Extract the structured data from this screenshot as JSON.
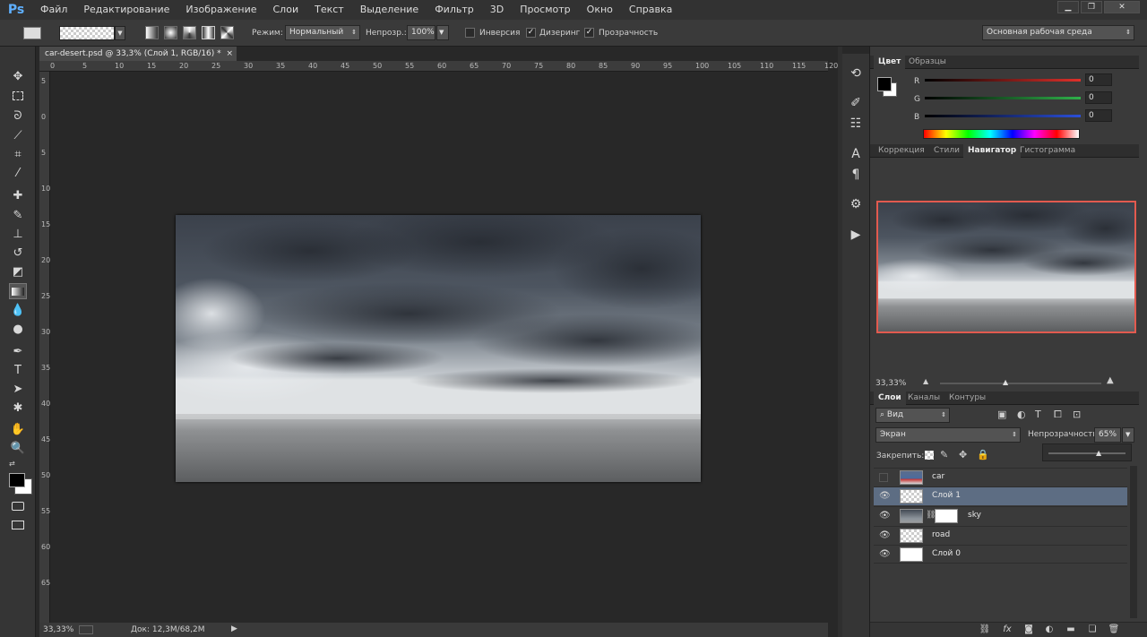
{
  "app": {
    "logo": "Ps"
  },
  "menu": [
    "Файл",
    "Редактирование",
    "Изображение",
    "Слои",
    "Текст",
    "Выделение",
    "Фильтр",
    "3D",
    "Просмотр",
    "Окно",
    "Справка"
  ],
  "window_controls": {
    "minimize": "▁",
    "restore": "❐",
    "close": "✕"
  },
  "options": {
    "mode_label": "Режим:",
    "mode_value": "Нормальный",
    "opacity_label": "Непрозр.:",
    "opacity_value": "100%",
    "inverse_label": "Инверсия",
    "dither_label": "Дизеринг",
    "transparency_label": "Прозрачность",
    "workspace_value": "Основная рабочая среда"
  },
  "document": {
    "tab_title": "car-desert.psd @ 33,3% (Слой 1, RGB/16) *",
    "ruler_top": [
      "0",
      "5",
      "10",
      "15",
      "20",
      "25",
      "30",
      "35",
      "40",
      "45",
      "50",
      "55",
      "60",
      "65",
      "70",
      "75",
      "80",
      "85",
      "90",
      "95",
      "100",
      "105",
      "110",
      "115",
      "120"
    ],
    "ruler_left": [
      "5",
      "0",
      "5",
      "10",
      "15",
      "20",
      "25",
      "30",
      "35",
      "40",
      "45",
      "50",
      "55",
      "60",
      "65"
    ]
  },
  "status": {
    "zoom": "33,33%",
    "doc_info": "Док: 12,3M/68,2M"
  },
  "color_panel": {
    "tabs": [
      "Цвет",
      "Образцы"
    ],
    "channels": [
      {
        "label": "R",
        "value": "0",
        "color": "#e0302a"
      },
      {
        "label": "G",
        "value": "0",
        "color": "#2fb14a"
      },
      {
        "label": "B",
        "value": "0",
        "color": "#2b4fd8"
      }
    ]
  },
  "navigator_panel": {
    "tabs": [
      "Коррекция",
      "Стили",
      "Навигатор",
      "Гистограмма"
    ],
    "active_tab": "Навигатор",
    "zoom": "33,33%",
    "view_box_color": "#e25a4f"
  },
  "layers_panel": {
    "tabs": [
      "Слои",
      "Каналы",
      "Контуры"
    ],
    "filter_label": "Вид",
    "blend_mode": "Экран",
    "opacity_label": "Непрозрачность:",
    "opacity_value": "65%",
    "lock_label": "Закрепить:",
    "layers": [
      {
        "name": "car",
        "visible": false,
        "selected": false
      },
      {
        "name": "Слой 1",
        "visible": true,
        "selected": true
      },
      {
        "name": "sky",
        "visible": true,
        "selected": false
      },
      {
        "name": "road",
        "visible": true,
        "selected": false
      },
      {
        "name": "Слой 0",
        "visible": true,
        "selected": false
      }
    ],
    "bottom_icons": [
      "link-icon",
      "fx-icon",
      "mask-icon",
      "adjustment-icon",
      "folder-icon",
      "new-layer-icon",
      "trash-icon"
    ]
  },
  "colors": {
    "accent_selection": "#5d6d83",
    "app_bg": "#282828"
  }
}
